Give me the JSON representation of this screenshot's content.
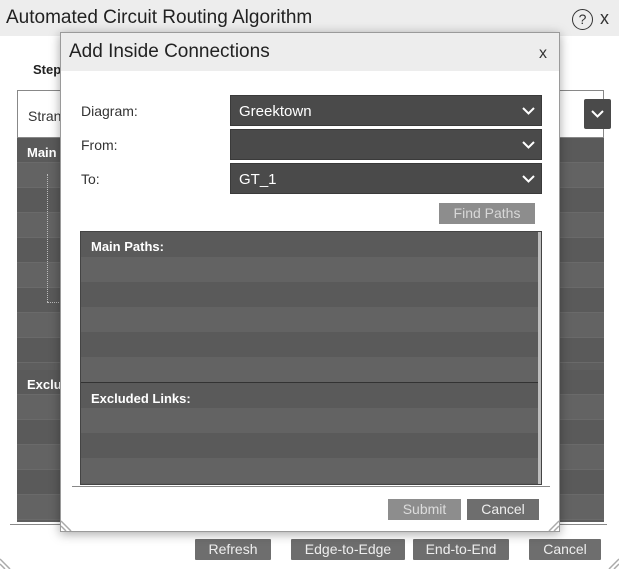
{
  "window": {
    "title": "Automated Circuit Routing Algorithm",
    "help_glyph": "?",
    "close_glyph": "x"
  },
  "background": {
    "step_label": "Step",
    "strand_label": "Stran",
    "main_header": "Main",
    "excluded_header": "Exclu",
    "buttons": {
      "refresh": "Refresh",
      "edge_to_edge": "Edge-to-Edge",
      "end_to_end": "End-to-End",
      "cancel": "Cancel"
    }
  },
  "dialog": {
    "title": "Add Inside Connections",
    "close_glyph": "x",
    "fields": {
      "diagram_label": "Diagram:",
      "diagram_value": "Greektown",
      "from_label": "From:",
      "from_value": "",
      "to_label": "To:",
      "to_value": "GT_1"
    },
    "find_paths_label": "Find Paths",
    "main_paths_header": "Main Paths:",
    "excluded_links_header": "Excluded Links:",
    "submit_label": "Submit",
    "cancel_label": "Cancel"
  },
  "colors": {
    "dropdown_bg": "#4a4a4a",
    "grid_bg": "#5e5e5e",
    "disabled_button": "#8d8d8d",
    "button": "#6e6e6e"
  }
}
